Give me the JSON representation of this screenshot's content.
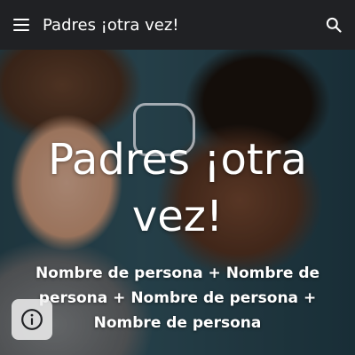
{
  "app_bar": {
    "title": "Padres ¡otra vez!",
    "menu_icon": "menu-icon",
    "search_icon": "search-icon"
  },
  "hero": {
    "title": "Padres ¡otra vez!",
    "subtitle": "Nombre de persona + Nombre de persona + Nombre de persona + Nombre de persona",
    "info_icon": "info-icon"
  },
  "colors": {
    "app_bar_bg": "#202124",
    "text": "#ffffff"
  }
}
